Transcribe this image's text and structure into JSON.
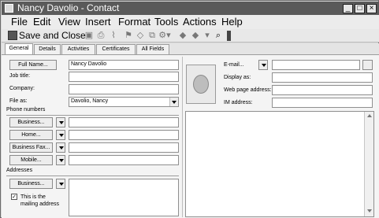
{
  "window": {
    "title": "Nancy Davolio - Contact",
    "minimize_glyph": "_",
    "maximize_glyph": "□",
    "close_glyph": "×"
  },
  "menu": {
    "items": [
      "File",
      "Edit",
      "View",
      "Insert",
      "Format",
      "Tools",
      "Actions",
      "Help"
    ]
  },
  "toolbar": {
    "save_close_label": "Save and Close"
  },
  "tabs": [
    "General",
    "Details",
    "Activities",
    "Certificates",
    "All Fields"
  ],
  "form": {
    "full_name_button": "Full Name...",
    "full_name_value": "Nancy Davolio",
    "job_title_label": "Job title:",
    "company_label": "Company:",
    "file_as_label": "File as:",
    "file_as_value": "Davolio, Nancy",
    "phone_section": "Phone numbers",
    "phones": [
      "Business...",
      "Home...",
      "Business Fax...",
      "Mobile..."
    ],
    "addresses_section": "Addresses",
    "address_button": "Business...",
    "mailing_checkbox_label": "This is the mailing address",
    "email_button": "E-mail...",
    "display_as_label": "Display as:",
    "web_page_label": "Web page address:",
    "im_address_label": "IM address:"
  },
  "icons": {
    "save": "floppy-icon",
    "contact_photo": "contact-photo-icon",
    "address_book": "address-book-icon"
  }
}
